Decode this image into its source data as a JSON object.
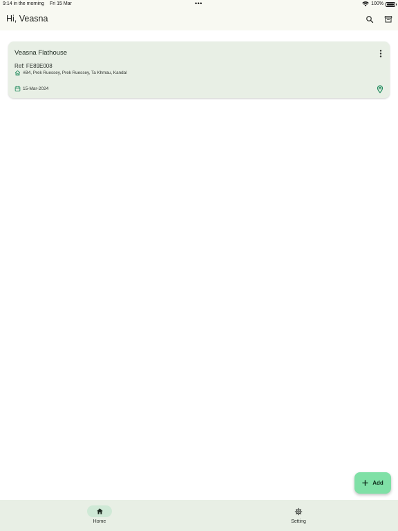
{
  "status_bar": {
    "time": "9:14 in the morning",
    "date": "Fri 15 Mar",
    "dots": "•••",
    "battery": "100%"
  },
  "app_bar": {
    "greeting": "Hi, Veasna",
    "icons": [
      "search-icon",
      "archive-icon"
    ]
  },
  "cards": [
    {
      "title": "Veasna Flathouse",
      "ref": "Ref: FE89E008",
      "address": "#B4, Prek Ruessey, Prek Ruessey, Ta Khmau, Kandal",
      "date": "15-Mar-2024",
      "icons": [
        "more-vert-icon",
        "home-icon",
        "calendar-icon",
        "location-pin-icon"
      ]
    }
  ],
  "fab": {
    "label": "Add",
    "icon": "plus-icon"
  },
  "bottom_nav": {
    "items": [
      {
        "label": "Home",
        "icon": "home-filled-icon",
        "selected": true
      },
      {
        "label": "Setting",
        "icon": "gear-icon",
        "selected": false
      }
    ]
  },
  "colors": {
    "accent": "#7fe0a6",
    "card_bg": "#e8efe5",
    "nav_bg": "#e8efe5",
    "selected_indicator": "#cfe9d6",
    "icon_green": "#1f8a5c",
    "top_bg": "#f8f9f2"
  }
}
